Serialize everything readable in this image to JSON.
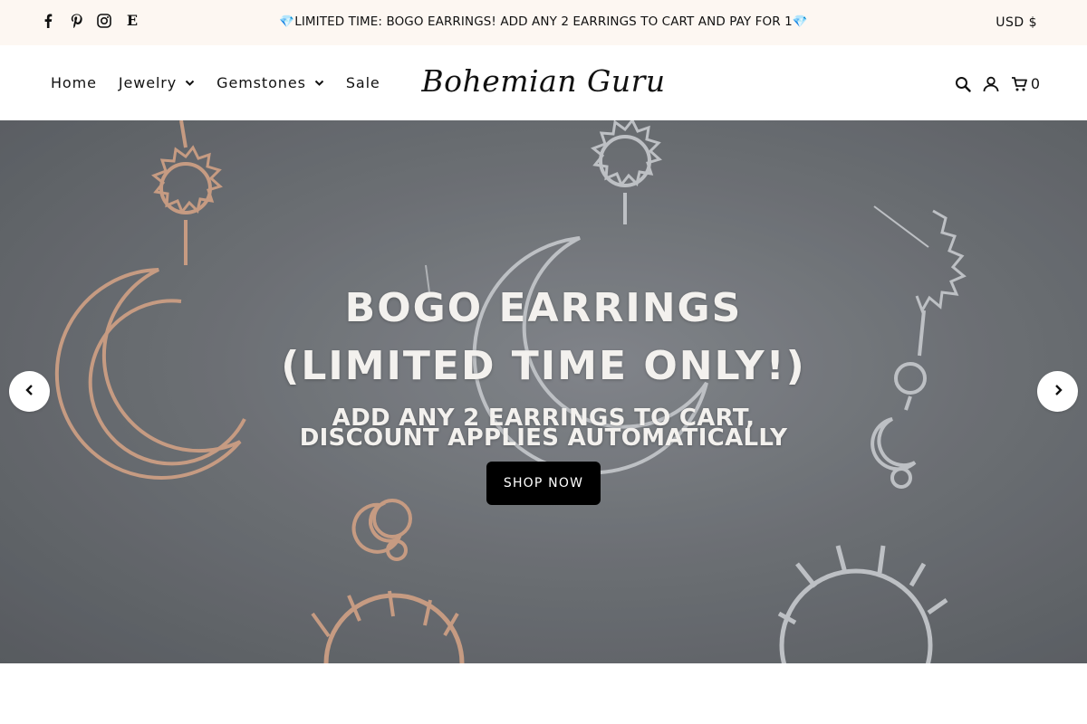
{
  "announcement": {
    "gem_left": "💎",
    "text": "LIMITED TIME: BOGO EARRINGS! ADD ANY 2 EARRINGS TO CART AND PAY FOR 1",
    "gem_right": "💎",
    "currency": "USD $",
    "social_icons": [
      "facebook-icon",
      "pinterest-icon",
      "instagram-icon",
      "etsy-icon"
    ],
    "etsy_glyph": "E"
  },
  "header": {
    "nav": [
      {
        "label": "Home",
        "has_dropdown": false
      },
      {
        "label": "Jewelry",
        "has_dropdown": true
      },
      {
        "label": "Gemstones",
        "has_dropdown": true
      },
      {
        "label": "Sale",
        "has_dropdown": false
      }
    ],
    "logo": "Bohemian Guru",
    "cart_count": "0",
    "icons": [
      "search-icon",
      "account-icon",
      "cart-icon"
    ]
  },
  "hero": {
    "title_line1": "BOGO EARRINGS",
    "title_line2": "(LIMITED TIME ONLY!)",
    "subtitle_line1": "ADD ANY 2 EARRINGS TO CART,",
    "subtitle_line2": "DISCOUNT APPLIES AUTOMATICALLY",
    "cta_label": "SHOP NOW"
  },
  "colors": {
    "announcement_bg": "#fdf7f2",
    "hero_bg": "#7a7e82",
    "cta_bg": "#000000",
    "rose_gold": "#d9a98c",
    "silver": "#c9ccd0"
  }
}
